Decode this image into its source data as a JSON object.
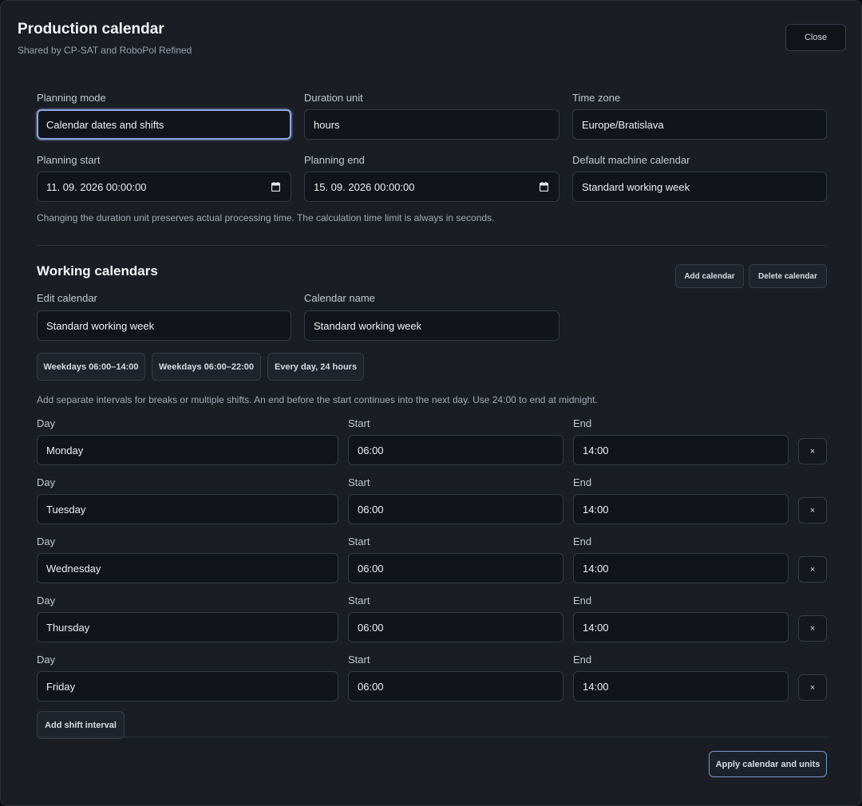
{
  "header": {
    "title": "Production calendar",
    "subtitle": "Shared by CP-SAT and RoboPol Refined",
    "close_label": "Close"
  },
  "settings": {
    "planning_mode": {
      "label": "Planning mode",
      "value": "Calendar dates and shifts"
    },
    "duration_unit": {
      "label": "Duration unit",
      "value": "hours"
    },
    "time_zone": {
      "label": "Time zone",
      "value": "Europe/Bratislava"
    },
    "planning_start": {
      "label": "Planning start",
      "value": "11. 09. 2026 00:00:00"
    },
    "planning_end": {
      "label": "Planning end",
      "value": "15. 09. 2026 00:00:00"
    },
    "default_calendar": {
      "label": "Default machine calendar",
      "value": "Standard working week"
    },
    "note": "Changing the duration unit preserves actual processing time. The calculation time limit is always in seconds."
  },
  "working_calendars": {
    "title": "Working calendars",
    "add_label": "Add calendar",
    "delete_label": "Delete calendar",
    "edit_calendar": {
      "label": "Edit calendar",
      "value": "Standard working week"
    },
    "calendar_name": {
      "label": "Calendar name",
      "value": "Standard working week"
    },
    "presets": [
      "Weekdays 06:00–14:00",
      "Weekdays 06:00–22:00",
      "Every day, 24 hours"
    ],
    "note": "Add separate intervals for breaks or multiple shifts. An end before the start continues into the next day. Use 24:00 to end at midnight.",
    "col_day": "Day",
    "col_start": "Start",
    "col_end": "End",
    "remove_glyph": "×",
    "intervals": [
      {
        "day": "Monday",
        "start": "06:00",
        "end": "14:00"
      },
      {
        "day": "Tuesday",
        "start": "06:00",
        "end": "14:00"
      },
      {
        "day": "Wednesday",
        "start": "06:00",
        "end": "14:00"
      },
      {
        "day": "Thursday",
        "start": "06:00",
        "end": "14:00"
      },
      {
        "day": "Friday",
        "start": "06:00",
        "end": "14:00"
      }
    ],
    "add_interval_label": "Add shift interval"
  },
  "footer": {
    "apply_label": "Apply calendar and units"
  },
  "colors": {
    "background": "#1a1d24",
    "field": "#11141a",
    "focus_accent": "#8fa9e6"
  }
}
